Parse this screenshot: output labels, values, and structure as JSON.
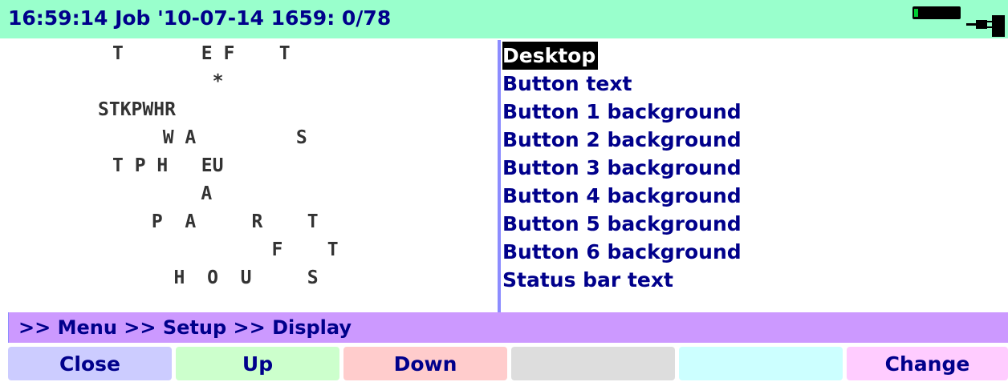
{
  "status_bar": {
    "text": "16:59:14 Job '10-07-14 1659: 0/78",
    "battery_icon": "battery-icon",
    "plug_icon": "power-plug-icon"
  },
  "steno_display": {
    "rows": [
      "T       E F    T",
      "         *",
      "STKPWHR",
      "  W A         S",
      "T P H   EU",
      "    A",
      " P  A     R    T",
      "          F    T",
      "   H  O  U     S"
    ]
  },
  "menu": {
    "items": [
      "Desktop",
      "Button text",
      "Button 1 background",
      "Button 2 background",
      "Button 3 background",
      "Button 4 background",
      "Button 5 background",
      "Button 6 background",
      "Status bar text"
    ],
    "selected_index": 0
  },
  "breadcrumb": ">> Menu >> Setup >> Display",
  "softkeys": [
    {
      "label": "Close",
      "color": "#ccccff"
    },
    {
      "label": "Up",
      "color": "#ccffcc"
    },
    {
      "label": "Down",
      "color": "#ffcccc"
    },
    {
      "label": "",
      "color": "#dddddd"
    },
    {
      "label": "",
      "color": "#ccffff"
    },
    {
      "label": "Change",
      "color": "#ffccff"
    }
  ],
  "colors": {
    "status_bg": "#99ffcc",
    "text_navy": "#00008b",
    "breadcrumb_bg": "#cc99ff",
    "divider": "#8c8cff"
  }
}
